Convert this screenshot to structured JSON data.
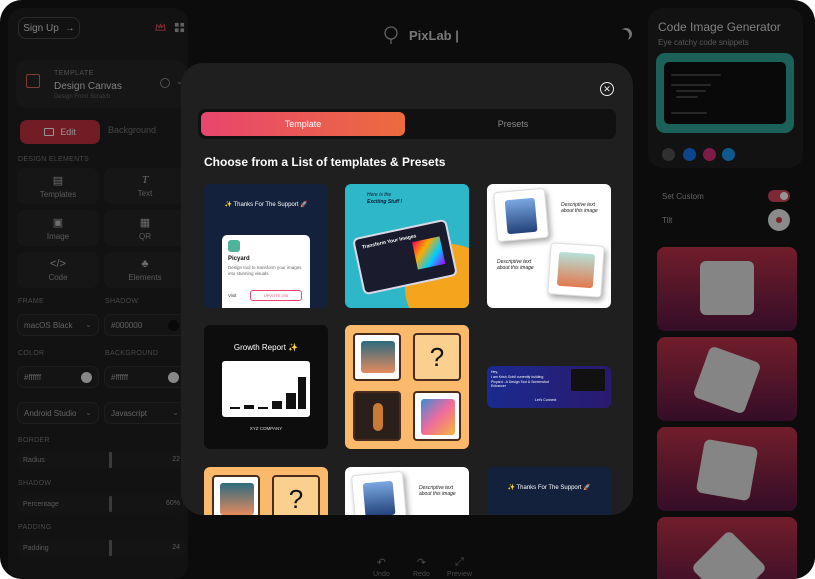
{
  "app": {
    "name": "PixLab |"
  },
  "left_panel": {
    "signup_label": "Sign Up",
    "template": {
      "section": "TEMPLATE",
      "value": "Design Canvas",
      "subtitle": "Design From Scratch"
    },
    "edit_label": "Edit",
    "background_label": "Background",
    "design_elements_title": "DESIGN ELEMENTS",
    "elements": [
      {
        "label": "Templates",
        "icon": "layers-icon"
      },
      {
        "label": "Text",
        "icon": "text-icon"
      },
      {
        "label": "Image",
        "icon": "image-icon"
      },
      {
        "label": "QR",
        "icon": "qr-icon"
      },
      {
        "label": "Code",
        "icon": "code-icon"
      },
      {
        "label": "Elements",
        "icon": "shapes-icon"
      }
    ],
    "frame": {
      "label": "FRAME",
      "value": "macOS Black"
    },
    "shadow_color": {
      "label": "SHADOW",
      "value": "#000000"
    },
    "color": {
      "label": "COLOR",
      "value": "#ffffff"
    },
    "background": {
      "label": "BACKGROUND",
      "value": "#ffffff"
    },
    "theme_select": "Android Studio",
    "language_select": "Javascript",
    "border": {
      "label": "BORDER",
      "field": "Radius",
      "value": "22"
    },
    "shadow": {
      "label": "SHADOW",
      "field": "Percentage",
      "value": "60%"
    },
    "padding": {
      "label": "PADDING",
      "field": "Padding",
      "value": "24"
    }
  },
  "bottom_bar": {
    "undo": "Undo",
    "redo": "Redo",
    "preview": "Preview"
  },
  "right_panel": {
    "title": "Code Image Generator",
    "subtitle": "Eye catchy code snippets",
    "set_custom_label": "Set Custom",
    "tilt_label": "Tilt"
  },
  "modal": {
    "tabs": [
      "Template",
      "Presets"
    ],
    "active_tab": "Template",
    "title": "Choose from a List of templates & Presets",
    "cards": {
      "thanks": {
        "text": "Thanks For The Support",
        "brand": "Picyard",
        "desc": "Design tool to transform your images into stunning visuals",
        "visit": "Visit",
        "badge": "UPVOTE 200"
      },
      "exciting": {
        "text1": "Here is the",
        "text2": "Exciting Stuff !",
        "screen": "Transform Your Images"
      },
      "desc_card": {
        "text": "Descriptive text about this image"
      },
      "growth": {
        "title": "Growth Report",
        "company": "XYZ COMPANY"
      },
      "hey": {
        "line1": "Hey,",
        "line2": "I am Krish Gohil currently building",
        "line3": "Picyard - A Design Tool & Screenshot Enhancer",
        "cta": "Let's Connect"
      }
    }
  },
  "colors": {
    "accent": "#c43340",
    "gradient_start": "#e8466e",
    "gradient_end": "#ec6b3e"
  }
}
